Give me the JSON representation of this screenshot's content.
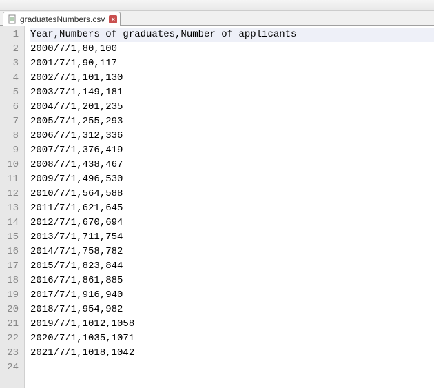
{
  "tab": {
    "filename": "graduatesNumbers.csv"
  },
  "lines": [
    "Year,Numbers of graduates,Number of applicants",
    "2000/7/1,80,100",
    "2001/7/1,90,117",
    "2002/7/1,101,130",
    "2003/7/1,149,181",
    "2004/7/1,201,235",
    "2005/7/1,255,293",
    "2006/7/1,312,336",
    "2007/7/1,376,419",
    "2008/7/1,438,467",
    "2009/7/1,496,530",
    "2010/7/1,564,588",
    "2011/7/1,621,645",
    "2012/7/1,670,694",
    "2013/7/1,711,754",
    "2014/7/1,758,782",
    "2015/7/1,823,844",
    "2016/7/1,861,885",
    "2017/7/1,916,940",
    "2018/7/1,954,982",
    "2019/7/1,1012,1058",
    "2020/7/1,1035,1071",
    "2021/7/1,1018,1042",
    ""
  ]
}
